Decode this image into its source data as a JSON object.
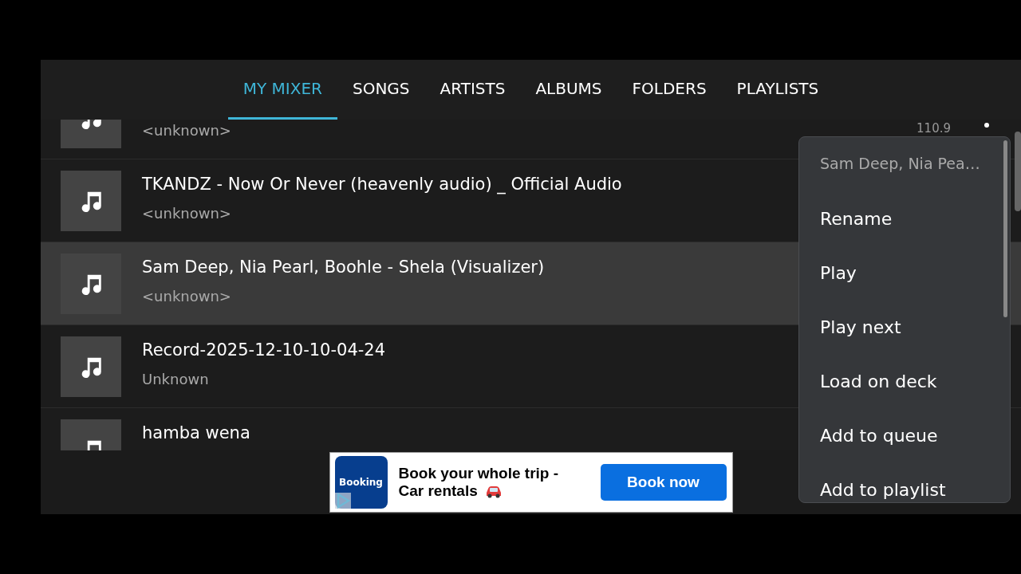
{
  "tabs": [
    {
      "label": "MY MIXER",
      "selected": true
    },
    {
      "label": "SONGS",
      "selected": false
    },
    {
      "label": "ARTISTS",
      "selected": false
    },
    {
      "label": "ALBUMS",
      "selected": false
    },
    {
      "label": "FOLDERS",
      "selected": false
    },
    {
      "label": "PLAYLISTS",
      "selected": false
    }
  ],
  "tracks": [
    {
      "subtitle": "<unknown>",
      "duration": "110.9",
      "selected": false
    },
    {
      "title": "TKANDZ - Now Or Never (heavenly audio) _ Official Audio",
      "subtitle": "<unknown>",
      "selected": false
    },
    {
      "title": "Sam Deep, Nia Pearl, Boohle - Shela (Visualizer)",
      "subtitle": "<unknown>",
      "selected": true
    },
    {
      "title": "Record-2025-12-10-10-04-24",
      "subtitle": "Unknown",
      "selected": false
    },
    {
      "title": "hamba wena",
      "selected": false
    }
  ],
  "context_menu": {
    "header": "Sam Deep, Nia Pea…",
    "items": [
      "Rename",
      "Play",
      "Play next",
      "Load on deck",
      "Add to queue",
      "Add to playlist"
    ]
  },
  "ad": {
    "logo": "Booking",
    "headline": "Book your whole trip -",
    "subline": "Car rentals",
    "button": "Book now"
  }
}
